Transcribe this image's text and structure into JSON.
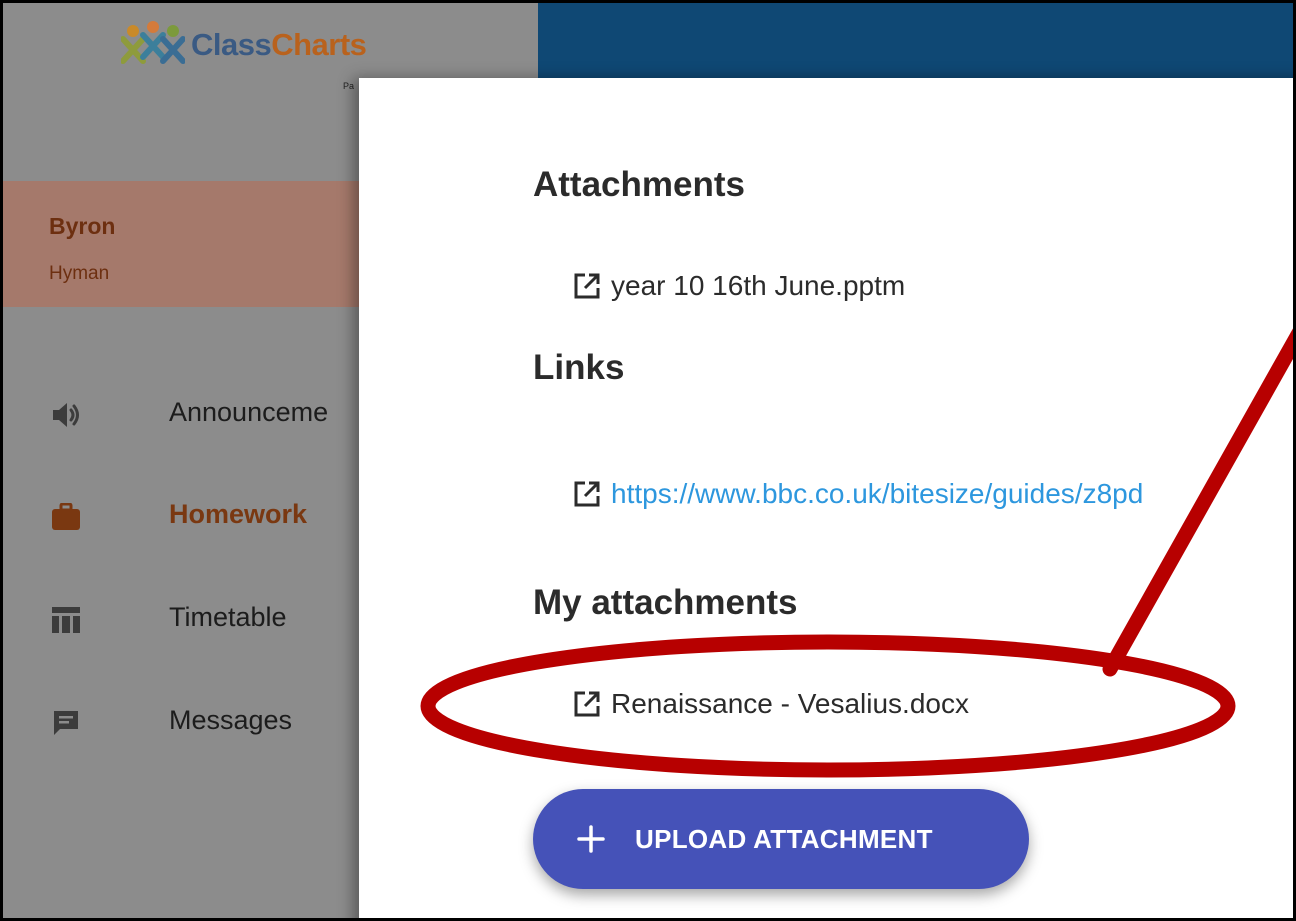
{
  "logo": {
    "name_part1": "Class",
    "name_part2": "Charts",
    "subtitle": "Pa"
  },
  "user": {
    "first_name": "Byron",
    "last_name": "Hyman"
  },
  "nav": {
    "items": [
      {
        "label": "Announceme",
        "icon": "speaker-icon",
        "active": false
      },
      {
        "label": "Homework",
        "icon": "briefcase-icon",
        "active": true
      },
      {
        "label": "Timetable",
        "icon": "timetable-icon",
        "active": false
      },
      {
        "label": "Messages",
        "icon": "message-icon",
        "active": false
      }
    ]
  },
  "modal": {
    "attachments": {
      "title": "Attachments",
      "items": [
        {
          "name": "year 10 16th June.pptm",
          "icon": "external-link-icon"
        }
      ]
    },
    "links": {
      "title": "Links",
      "items": [
        {
          "url": "https://www.bbc.co.uk/bitesize/guides/z8pd",
          "icon": "external-link-icon"
        }
      ]
    },
    "my_attachments": {
      "title": "My attachments",
      "items": [
        {
          "name": "Renaissance - Vesalius.docx",
          "icon": "external-link-icon"
        }
      ]
    },
    "upload_button": {
      "label": "UPLOAD ATTACHMENT",
      "icon": "plus-icon"
    }
  },
  "colors": {
    "topbar": "#0f4874",
    "sidebar_overlay": "#8c8c8c",
    "user_card": "#a5796b",
    "active_nav": "#7a3811",
    "link": "#2d97de",
    "button": "#4552b8",
    "annotation": "#b70000"
  }
}
